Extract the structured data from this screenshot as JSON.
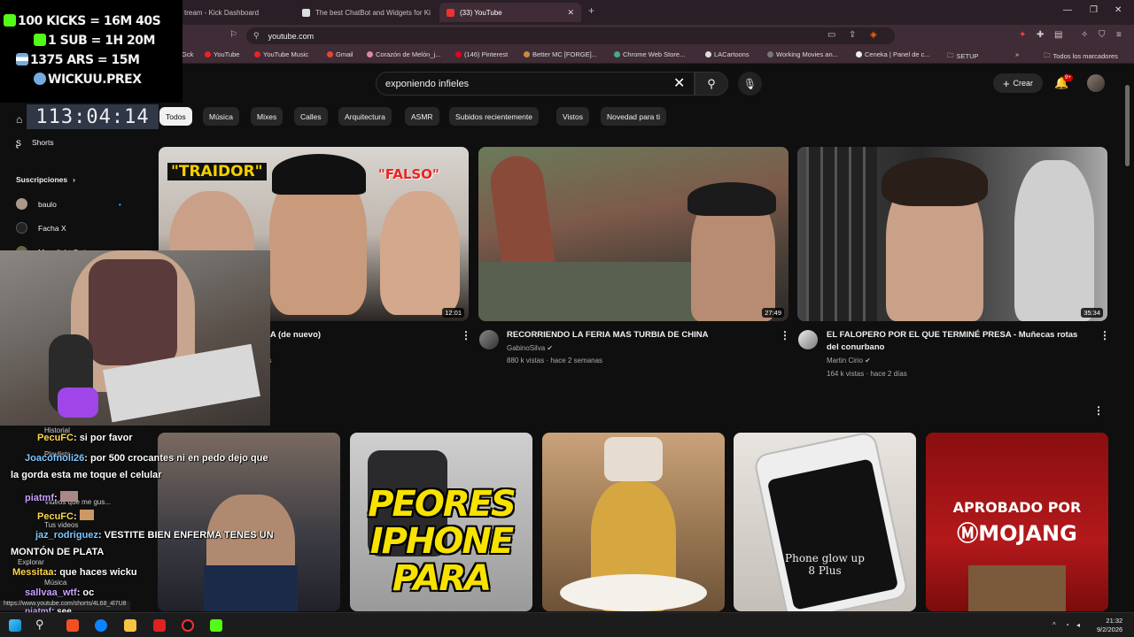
{
  "browser": {
    "tabs": [
      {
        "label": "tream - Kick Dashboard"
      },
      {
        "label": "The best ChatBot and Widgets for Ki"
      },
      {
        "label": "(33) YouTube"
      }
    ],
    "new_tab": "+",
    "url": "youtube.com",
    "bookmarks": [
      "Gck",
      "YouTube",
      "YouTube Music",
      "Gmail",
      "Corazón de Melón_j...",
      "(146) Pinterest",
      "Better MC [FORGE]...",
      "Chrome Web Store...",
      "LACartoons",
      "Working Movies an...",
      "Ceneka | Panel de c...",
      "SETUP",
      "Todos los marcadores"
    ],
    "bookmarks_more": "»",
    "status_url": "https://www.youtube.com/shorts/4L68_4l7U8"
  },
  "youtube": {
    "search_query": "exponiendo infieles",
    "create_label": "Crear",
    "notification_count": "9+",
    "chips": [
      "Todos",
      "Música",
      "Mixes",
      "Calles",
      "Arquitectura",
      "ASMR",
      "Subidos recientemente",
      "Vistos",
      "Novedad para ti"
    ],
    "sidebar": {
      "shorts": "Shorts",
      "subscriptions": "Suscripciones",
      "subs": [
        "baulo",
        "Facha X",
        "Moonlight Cottage"
      ],
      "under": [
        "Historial",
        "Playlists",
        "Videos que me gus...",
        "Tus videos",
        "Explorar",
        "Música"
      ]
    },
    "videos": [
      {
        "title_partial": "CA (de nuevo)",
        "meta_partial": "as",
        "duration": "12:01",
        "thumb_texts": [
          "\"TRAIDOR\"",
          "\"FALSO\""
        ]
      },
      {
        "title": "RECORRIENDO LA FERIA MAS TURBIA DE CHINA",
        "channel": "GabinoSilva",
        "meta": "880 k vistas · hace 2 semanas",
        "duration": "27:49"
      },
      {
        "title_line1": "EL FALOPERO POR EL QUE TERMINÉ PRESA - Muñecas rotas",
        "title_line2": "del conurbano",
        "channel": "Martin Cirio",
        "meta": "164 k vistas · hace 2 días",
        "duration": "35:34"
      }
    ],
    "shorts_row": [
      {
        "text": ""
      },
      {
        "text_lines": [
          "PEORES",
          "IPHONE",
          "PARA"
        ]
      },
      {
        "text": ""
      },
      {
        "text_lines": [
          "Phone glow up",
          "8 Plus"
        ]
      },
      {
        "text_lines": [
          "APROBADO POR",
          "MOJANG"
        ]
      }
    ]
  },
  "overlay": {
    "lines": [
      "100 KICKS = 16M 40S",
      "1 SUB = 1H 20M",
      "1375 ARS = 15M",
      "WICKUU.PREX"
    ],
    "timer": "113:04:14",
    "chat": [
      {
        "user": "PecuFC",
        "msg": ": si por favor"
      },
      {
        "user": "Joacofnoli26",
        "msg": ": por 500 crocantes ni en pedo dejo que"
      },
      {
        "user": "",
        "msg": "la gorda esta me toque el celular"
      },
      {
        "user": "piatmf",
        "msg": ":"
      },
      {
        "user": "PecuFC",
        "msg": ":"
      },
      {
        "user": "jaz_rodriguez",
        "msg": ": VESTITE BIEN ENFERMA TENES UN"
      },
      {
        "user": "",
        "msg": "MONTÓN DE PLATA"
      },
      {
        "user": "Messitaa",
        "msg": ": que haces wicku"
      },
      {
        "user": "sallvaa_wtf",
        "msg": ": oc"
      },
      {
        "user": "piatmf",
        "msg": ": see"
      }
    ]
  },
  "taskbar": {
    "time": "21:32",
    "date": "9/2/2026"
  }
}
